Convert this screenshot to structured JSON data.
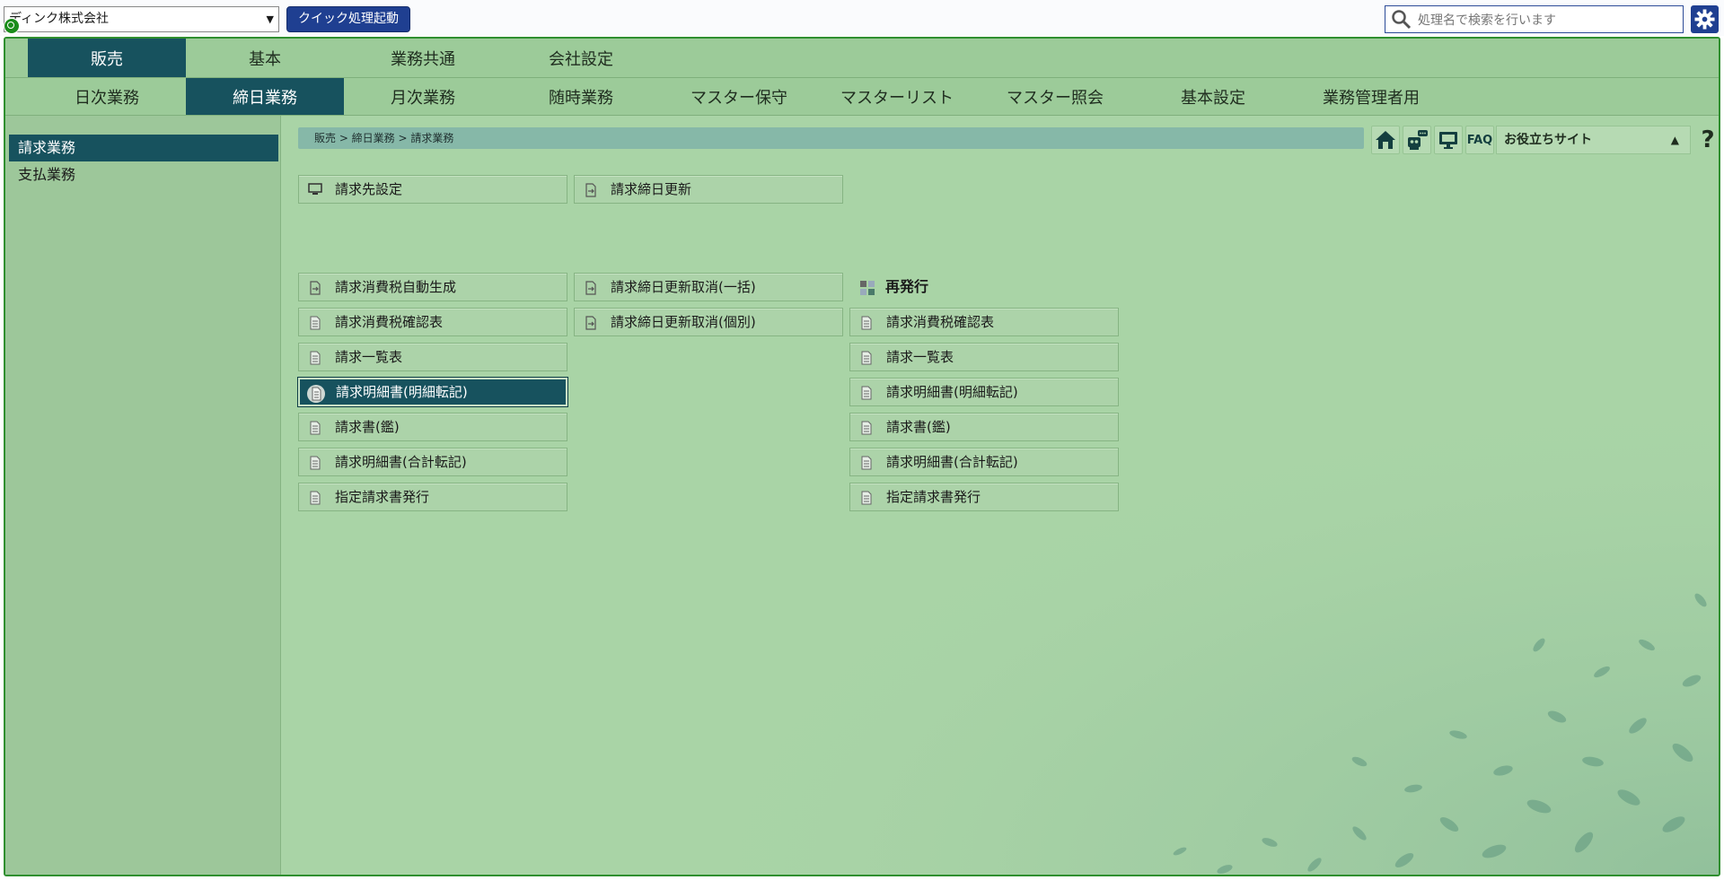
{
  "topbar": {
    "company": "ディンク株式会社",
    "quick_button": "クイック処理起動",
    "search_placeholder": "処理名で検索を行います"
  },
  "tabs_primary": [
    {
      "label": "販売",
      "active": true
    },
    {
      "label": "基本",
      "active": false
    },
    {
      "label": "業務共通",
      "active": false
    },
    {
      "label": "会社設定",
      "active": false
    }
  ],
  "tabs_secondary": [
    {
      "label": "日次業務",
      "active": false
    },
    {
      "label": "締日業務",
      "active": true
    },
    {
      "label": "月次業務",
      "active": false
    },
    {
      "label": "随時業務",
      "active": false
    },
    {
      "label": "マスター保守",
      "active": false
    },
    {
      "label": "マスターリスト",
      "active": false
    },
    {
      "label": "マスター照会",
      "active": false
    },
    {
      "label": "基本設定",
      "active": false
    },
    {
      "label": "業務管理者用",
      "active": false
    }
  ],
  "sidebar": {
    "items": [
      {
        "label": "請求業務",
        "active": true
      },
      {
        "label": "支払業務",
        "active": false
      }
    ]
  },
  "breadcrumb": "販売 > 締日業務 > 請求業務",
  "toolbar": {
    "faq": "FAQ",
    "useful_site": "お役立ちサイト",
    "help": "?"
  },
  "menu": {
    "col1": [
      {
        "label": "請求先設定",
        "icon": "monitor-icon"
      },
      {
        "label": "請求消費税自動生成",
        "icon": "process-icon"
      },
      {
        "label": "請求消費税確認表",
        "icon": "document-icon"
      },
      {
        "label": "請求一覧表",
        "icon": "document-icon"
      },
      {
        "label": "請求明細書(明細転記)",
        "icon": "document-icon",
        "selected": true
      },
      {
        "label": "請求書(鑑)",
        "icon": "document-icon"
      },
      {
        "label": "請求明細書(合計転記)",
        "icon": "document-icon"
      },
      {
        "label": "指定請求書発行",
        "icon": "document-icon"
      }
    ],
    "col2": [
      {
        "label": "請求締日更新",
        "icon": "process-icon"
      },
      {
        "label": "請求締日更新取消(一括)",
        "icon": "process-icon"
      },
      {
        "label": "請求締日更新取消(個別)",
        "icon": "process-icon"
      }
    ],
    "reissue": {
      "heading": "再発行",
      "items": [
        {
          "label": "請求消費税確認表",
          "icon": "document-icon"
        },
        {
          "label": "請求一覧表",
          "icon": "document-icon"
        },
        {
          "label": "請求明細書(明細転記)",
          "icon": "document-icon"
        },
        {
          "label": "請求書(鑑)",
          "icon": "document-icon"
        },
        {
          "label": "請求明細書(合計転記)",
          "icon": "document-icon"
        },
        {
          "label": "指定請求書発行",
          "icon": "document-icon"
        }
      ]
    }
  },
  "colors": {
    "accent": "#17525e",
    "background": "#a9d4a6",
    "primary_button": "#1f3f91",
    "frame_border": "#2f8f2f"
  }
}
